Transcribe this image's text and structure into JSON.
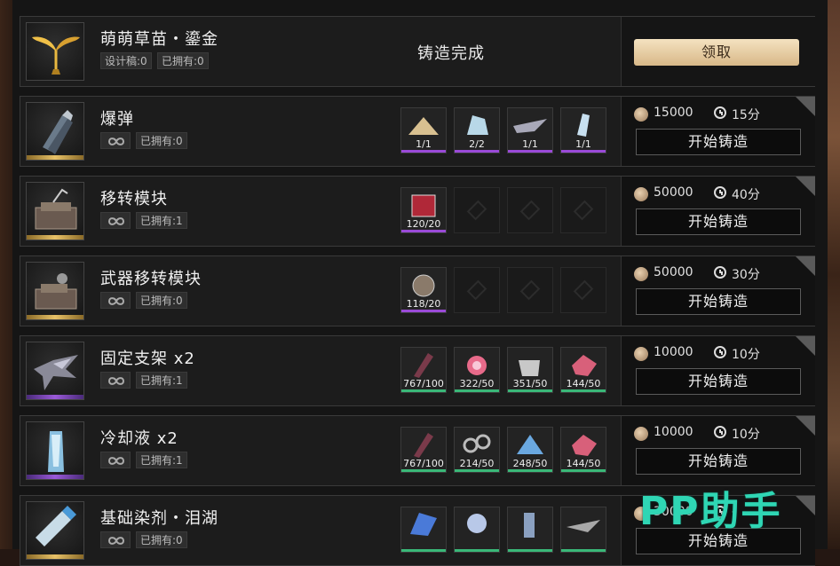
{
  "completed_item": {
    "name": "萌萌草苗・鎏金",
    "blueprint_label": "设计稿:0",
    "owned_label": "已拥有:0",
    "status": "铸造完成",
    "claim_label": "领取"
  },
  "recipes": [
    {
      "name": "爆弹",
      "owned_label": "已拥有:0",
      "rarity_color": "#e8c268",
      "coins": "15000",
      "time": "15分",
      "button_label": "开始铸造",
      "materials": [
        {
          "count": "1/1",
          "line": "purple",
          "icon": "powder-pile-icon"
        },
        {
          "count": "2/2",
          "line": "purple",
          "icon": "crystal-shard-icon"
        },
        {
          "count": "1/1",
          "line": "purple",
          "icon": "wing-blade-icon"
        },
        {
          "count": "1/1",
          "line": "purple",
          "icon": "ice-crystal-icon"
        }
      ]
    },
    {
      "name": "移转模块",
      "owned_label": "已拥有:1",
      "rarity_color": "#e8c268",
      "coins": "50000",
      "time": "40分",
      "button_label": "开始铸造",
      "materials": [
        {
          "count": "120/20",
          "line": "purple",
          "icon": "red-cube-icon"
        }
      ]
    },
    {
      "name": "武器移转模块",
      "owned_label": "已拥有:0",
      "rarity_color": "#e8c268",
      "coins": "50000",
      "time": "30分",
      "button_label": "开始铸造",
      "materials": [
        {
          "count": "118/20",
          "line": "purple",
          "icon": "dice-orb-icon"
        }
      ]
    },
    {
      "name": "固定支架 x2",
      "owned_label": "已拥有:1",
      "rarity_color": "#9a5ad8",
      "coins": "10000",
      "time": "10分",
      "button_label": "开始铸造",
      "materials": [
        {
          "count": "767/100",
          "line": "green",
          "icon": "feather-icon"
        },
        {
          "count": "322/50",
          "line": "green",
          "icon": "pink-flower-icon"
        },
        {
          "count": "351/50",
          "line": "green",
          "icon": "bone-skull-icon"
        },
        {
          "count": "144/50",
          "line": "green",
          "icon": "pink-gem-icon"
        }
      ]
    },
    {
      "name": "冷却液 x2",
      "owned_label": "已拥有:1",
      "rarity_color": "#9a5ad8",
      "coins": "10000",
      "time": "10分",
      "button_label": "开始铸造",
      "materials": [
        {
          "count": "767/100",
          "line": "green",
          "icon": "feather-icon"
        },
        {
          "count": "214/50",
          "line": "green",
          "icon": "chain-icon"
        },
        {
          "count": "248/50",
          "line": "green",
          "icon": "blue-crystal-icon"
        },
        {
          "count": "144/50",
          "line": "green",
          "icon": "pink-gem-icon"
        }
      ]
    },
    {
      "name": "基础染剂・泪湖",
      "owned_label": "已拥有:0",
      "coins": "30000",
      "time": "-",
      "button_label": "开始铸造",
      "materials": [
        {
          "count": "",
          "line": "green",
          "icon": "blue-wing-icon"
        },
        {
          "count": "",
          "line": "green",
          "icon": "crystal-flower-icon"
        },
        {
          "count": "",
          "line": "green",
          "icon": "tube-icon"
        },
        {
          "count": "",
          "line": "green",
          "icon": "grey-wing-icon"
        }
      ]
    }
  ],
  "watermark": "PP助手"
}
